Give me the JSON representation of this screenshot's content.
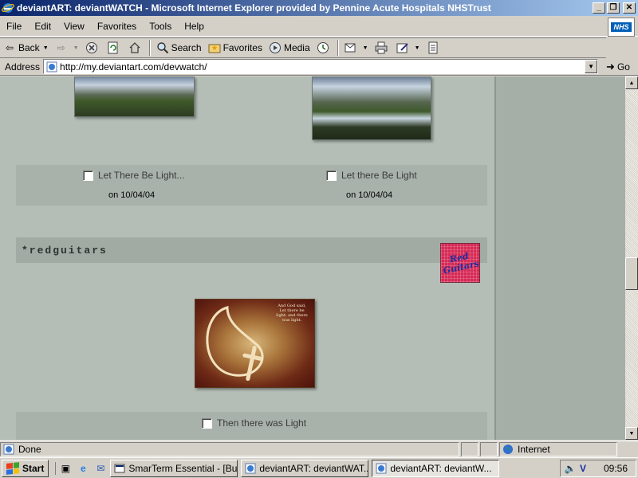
{
  "window": {
    "title": "deviantART: deviantWATCH - Microsoft Internet Explorer provided by Pennine Acute Hospitals NHSTrust",
    "minimize": "_",
    "maximize": "❐",
    "close": "✕",
    "logo_text": "NHS"
  },
  "menubar": {
    "items": [
      "File",
      "Edit",
      "View",
      "Favorites",
      "Tools",
      "Help"
    ]
  },
  "toolbar": {
    "back_label": "Back",
    "search_label": "Search",
    "favorites_label": "Favorites",
    "media_label": "Media"
  },
  "address": {
    "label": "Address",
    "url": "http://my.deviantart.com/devwatch/",
    "go_label": "Go"
  },
  "content": {
    "deviations_top": [
      {
        "title": "Let There Be Light...",
        "date": "on 10/04/04"
      },
      {
        "title": "Let there Be Light",
        "date": "on 10/04/04"
      }
    ],
    "user": {
      "name": "*redguitars",
      "avatar_text": "Red Guitars"
    },
    "deviation_bottom": {
      "title": "Then there was Light",
      "image_caption": "And God said, Let there be light: and there was light."
    }
  },
  "statusbar": {
    "status": "Done",
    "zone": "Internet"
  },
  "taskbar": {
    "start_label": "Start",
    "tasks": [
      {
        "label": "SmarTerm Essential - [Bur..."
      },
      {
        "label": "deviantART: deviantWAT..."
      },
      {
        "label": "deviantART: deviantW..."
      }
    ],
    "clock": "09:56"
  },
  "colors": {
    "page_bg": "#b4bdb6",
    "user_bar": "#a1aba4",
    "title_bar": "#0a246a"
  }
}
